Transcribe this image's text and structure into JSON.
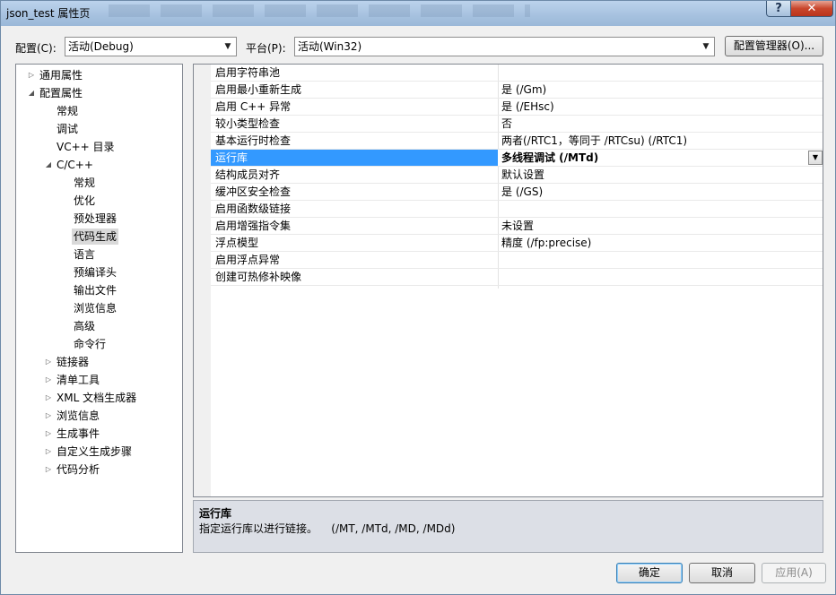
{
  "window": {
    "title": "json_test 属性页",
    "help_label": "?",
    "close_label": "✕"
  },
  "toolbar": {
    "config_label": "配置(C):",
    "config_value": "活动(Debug)",
    "platform_label": "平台(P):",
    "platform_value": "活动(Win32)",
    "config_manager_label": "配置管理器(O)..."
  },
  "tree": {
    "items": [
      {
        "label": "通用属性",
        "level": 0,
        "toggle": "collapsed"
      },
      {
        "label": "配置属性",
        "level": 0,
        "toggle": "expanded"
      },
      {
        "label": "常规",
        "level": 1,
        "toggle": "none"
      },
      {
        "label": "调试",
        "level": 1,
        "toggle": "none"
      },
      {
        "label": "VC++ 目录",
        "level": 1,
        "toggle": "none"
      },
      {
        "label": "C/C++",
        "level": 1,
        "toggle": "expanded"
      },
      {
        "label": "常规",
        "level": 2,
        "toggle": "none"
      },
      {
        "label": "优化",
        "level": 2,
        "toggle": "none"
      },
      {
        "label": "预处理器",
        "level": 2,
        "toggle": "none"
      },
      {
        "label": "代码生成",
        "level": 2,
        "toggle": "none",
        "selected": true
      },
      {
        "label": "语言",
        "level": 2,
        "toggle": "none"
      },
      {
        "label": "预编译头",
        "level": 2,
        "toggle": "none"
      },
      {
        "label": "输出文件",
        "level": 2,
        "toggle": "none"
      },
      {
        "label": "浏览信息",
        "level": 2,
        "toggle": "none"
      },
      {
        "label": "高级",
        "level": 2,
        "toggle": "none"
      },
      {
        "label": "命令行",
        "level": 2,
        "toggle": "none"
      },
      {
        "label": "链接器",
        "level": 1,
        "toggle": "collapsed"
      },
      {
        "label": "清单工具",
        "level": 1,
        "toggle": "collapsed"
      },
      {
        "label": "XML 文档生成器",
        "level": 1,
        "toggle": "collapsed"
      },
      {
        "label": "浏览信息",
        "level": 1,
        "toggle": "collapsed"
      },
      {
        "label": "生成事件",
        "level": 1,
        "toggle": "collapsed"
      },
      {
        "label": "自定义生成步骤",
        "level": 1,
        "toggle": "collapsed"
      },
      {
        "label": "代码分析",
        "level": 1,
        "toggle": "collapsed"
      }
    ]
  },
  "properties": {
    "rows": [
      {
        "name": "启用字符串池",
        "value": ""
      },
      {
        "name": "启用最小重新生成",
        "value": "是 (/Gm)"
      },
      {
        "name": "启用 C++ 异常",
        "value": "是 (/EHsc)"
      },
      {
        "name": "较小类型检查",
        "value": "否"
      },
      {
        "name": "基本运行时检查",
        "value": "两者(/RTC1，等同于 /RTCsu) (/RTC1)"
      },
      {
        "name": "运行库",
        "value": "多线程调试 (/MTd)",
        "selected": true
      },
      {
        "name": "结构成员对齐",
        "value": "默认设置"
      },
      {
        "name": "缓冲区安全检查",
        "value": "是 (/GS)"
      },
      {
        "name": "启用函数级链接",
        "value": ""
      },
      {
        "name": "启用增强指令集",
        "value": "未设置"
      },
      {
        "name": "浮点模型",
        "value": "精度 (/fp:precise)"
      },
      {
        "name": "启用浮点异常",
        "value": ""
      },
      {
        "name": "创建可热修补映像",
        "value": ""
      }
    ]
  },
  "description": {
    "title": "运行库",
    "text": "指定运行库以进行链接。    (/MT, /MTd, /MD, /MDd)"
  },
  "footer": {
    "ok_label": "确定",
    "cancel_label": "取消",
    "apply_label": "应用(A)"
  }
}
